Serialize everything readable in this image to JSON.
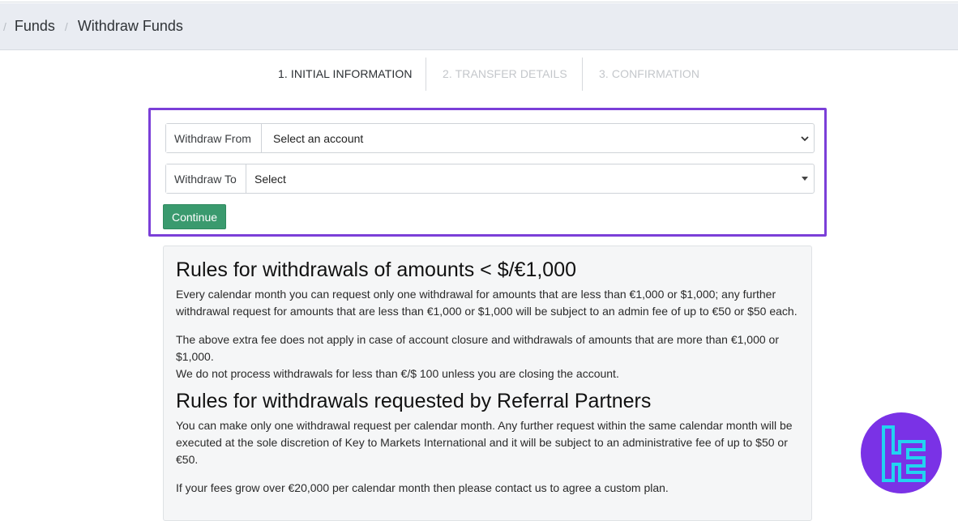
{
  "breadcrumb": {
    "items": [
      "Funds",
      "Withdraw Funds"
    ]
  },
  "steps": [
    {
      "label": "1. INITIAL INFORMATION",
      "state": "active"
    },
    {
      "label": "2. TRANSFER DETAILS",
      "state": "inactive"
    },
    {
      "label": "3. CONFIRMATION",
      "state": "inactive"
    }
  ],
  "form": {
    "withdraw_from_label": "Withdraw From",
    "withdraw_from_value": "Select an account",
    "withdraw_to_label": "Withdraw To",
    "withdraw_to_value": "Select",
    "continue_label": "Continue"
  },
  "rules": {
    "section1_title": "Rules for withdrawals of amounts < $/€1,000",
    "section1_p1": "Every calendar month you can request only one withdrawal for amounts that are less than €1,000 or $1,000; any further withdrawal request for amounts that are less than €1,000 or $1,000 will be subject to an admin fee of up to €50 or $50 each.",
    "section1_p2": "The above extra fee does not apply in case of account closure and withdrawals of amounts that are more than €1,000 or $1,000.",
    "section1_p3": "We do not process withdrawals for less than €/$ 100 unless you are closing the account.",
    "section2_title": "Rules for withdrawals requested by Referral Partners",
    "section2_p1": "You can make only one withdrawal request per calendar month. Any further request within the same calendar month will be executed at the sole discretion of Key to Markets International and it will be subject to an administrative fee of up to $50 or €50.",
    "section2_p2": "If your fees grow over €20,000 per calendar month then please contact us to agree a custom plan."
  },
  "colors": {
    "accent_border": "#7b3fd8",
    "continue_bg": "#3a9a6e",
    "logo_bg": "#7a32e6",
    "logo_fg": "#22d3f0"
  },
  "icons": {
    "from_select": "chevron-down-icon",
    "to_select": "caret-down-icon",
    "logo": "brand-logo-icon"
  }
}
